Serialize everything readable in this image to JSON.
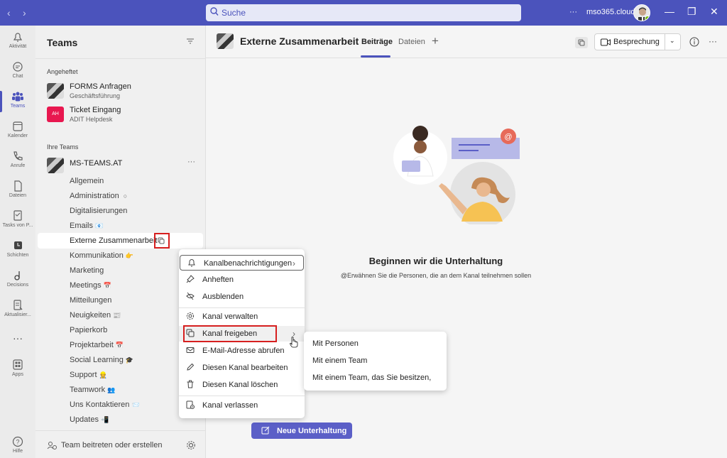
{
  "titlebar": {
    "search_placeholder": "Suche",
    "more_label": "···",
    "tenant": "mso365.cloud"
  },
  "rail": [
    {
      "label": "Aktivität",
      "icon": "bell-icon"
    },
    {
      "label": "Chat",
      "icon": "chat-icon"
    },
    {
      "label": "Teams",
      "icon": "teams-icon",
      "active": true
    },
    {
      "label": "Kalender",
      "icon": "calendar-icon"
    },
    {
      "label": "Anrufe",
      "icon": "phone-icon"
    },
    {
      "label": "Dateien",
      "icon": "file-icon"
    },
    {
      "label": "Tasks von P...",
      "icon": "tasks-icon"
    },
    {
      "label": "Schichten",
      "icon": "shifts-icon"
    },
    {
      "label": "Decisions",
      "icon": "decisions-icon"
    },
    {
      "label": "Aktualisier...",
      "icon": "updates-icon"
    },
    {
      "label": "···",
      "icon": "more-icon"
    },
    {
      "label": "Apps",
      "icon": "apps-icon"
    },
    {
      "label": "Hilfe",
      "icon": "help-icon"
    }
  ],
  "sidebar": {
    "title": "Teams",
    "pinned_label": "Angeheftet",
    "pinned": [
      {
        "name": "FORMS Anfragen",
        "sub": "Geschäftsführung"
      },
      {
        "name": "Ticket Eingang",
        "sub": "ADIT Helpdesk",
        "badge": "AH"
      }
    ],
    "your_teams_label": "Ihre Teams",
    "team": {
      "name": "MS-TEAMS.AT",
      "more": "···"
    },
    "channels": [
      {
        "name": "Allgemein",
        "emoji": ""
      },
      {
        "name": "Administration",
        "emoji": "🔒"
      },
      {
        "name": "Digitalisierungen",
        "emoji": ""
      },
      {
        "name": "Emails",
        "emoji": "📧"
      },
      {
        "name": "Externe Zusammenarbeit",
        "emoji": ""
      },
      {
        "name": "Kommunikation",
        "emoji": "👉"
      },
      {
        "name": "Marketing",
        "emoji": ""
      },
      {
        "name": "Meetings",
        "emoji": "📅"
      },
      {
        "name": "Mitteilungen",
        "emoji": ""
      },
      {
        "name": "Neuigkeiten",
        "emoji": "📰"
      },
      {
        "name": "Papierkorb",
        "emoji": ""
      },
      {
        "name": "Projektarbeit",
        "emoji": "📅"
      },
      {
        "name": "Social Learning",
        "emoji": "🎓"
      },
      {
        "name": "Support",
        "emoji": "👷"
      },
      {
        "name": "Teamwork",
        "emoji": "👥"
      },
      {
        "name": "Uns Kontaktieren",
        "emoji": "📨"
      },
      {
        "name": "Updates",
        "emoji": "📲"
      }
    ],
    "join_label": "Team beitreten oder erstellen"
  },
  "header": {
    "channel_title": "Externe Zusammenarbeit",
    "tabs": [
      "Beiträge",
      "Dateien"
    ],
    "add_tab": "+",
    "meeting_label": "Besprechung"
  },
  "empty": {
    "title": "Beginnen wir die Unterhaltung",
    "subtitle": "@Erwähnen Sie die Personen, die an dem Kanal teilnehmen sollen",
    "button": "Neue Unterhaltung"
  },
  "context_menu": [
    {
      "label": "Kanalbenachrichtigungen",
      "icon": "bell-icon",
      "arrow": true
    },
    {
      "label": "Anheften",
      "icon": "pin-icon"
    },
    {
      "label": "Ausblenden",
      "icon": "hide-icon"
    },
    {
      "label": "Kanal verwalten",
      "icon": "gear-icon"
    },
    {
      "label": "Kanal freigeben",
      "icon": "share-channel-icon",
      "arrow": true
    },
    {
      "label": "E-Mail-Adresse abrufen",
      "icon": "mail-icon"
    },
    {
      "label": "Diesen Kanal bearbeiten",
      "icon": "edit-icon"
    },
    {
      "label": "Diesen Kanal löschen",
      "icon": "trash-icon"
    },
    {
      "label": "Kanal verlassen",
      "icon": "leave-icon"
    }
  ],
  "submenu": [
    "Mit Personen",
    "Mit einem Team",
    "Mit einem Team, das Sie besitzen,"
  ],
  "colors": {
    "brand": "#4b53bc",
    "highlight": "#d61f1f",
    "button": "#5b5fc7"
  }
}
